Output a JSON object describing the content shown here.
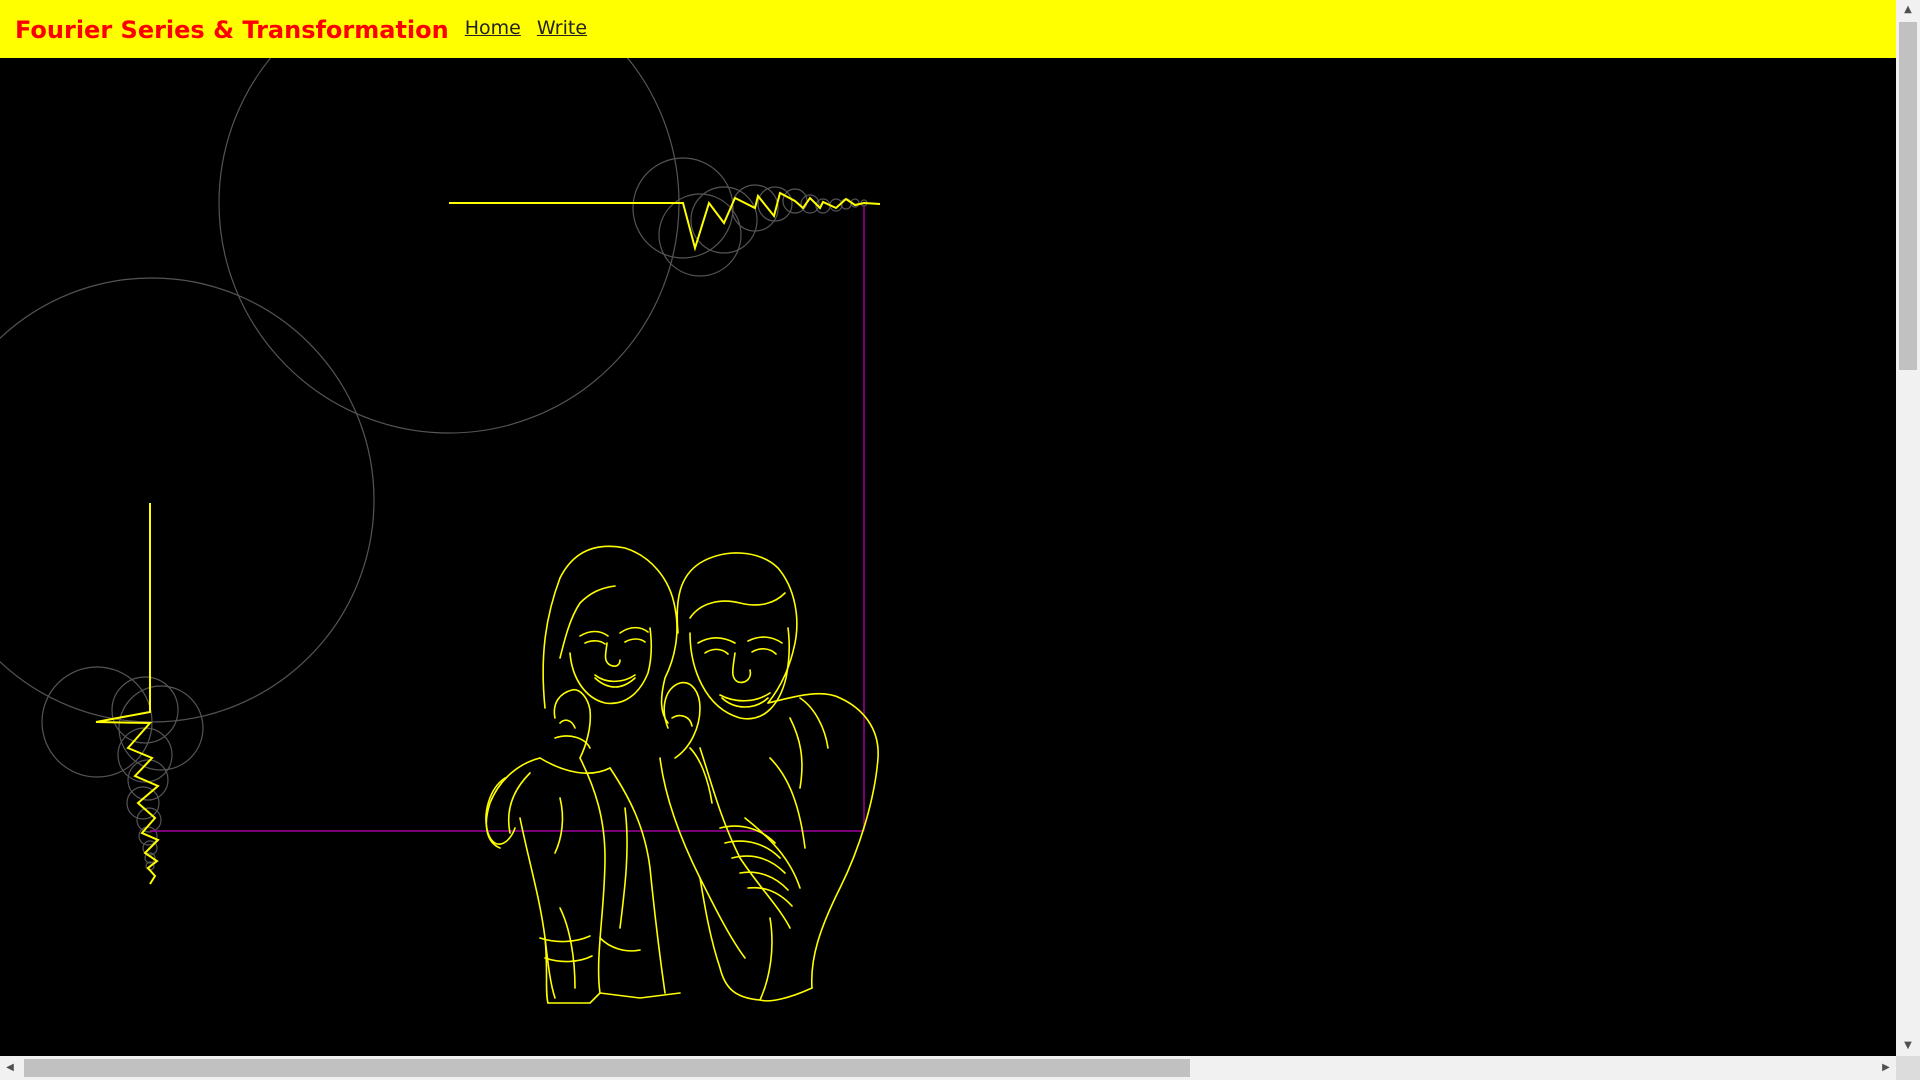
{
  "navbar": {
    "brand": "Fourier Series & Transformation",
    "links": [
      "Home",
      "Write"
    ],
    "background": "#ffff00",
    "brand_color": "#ff0000"
  },
  "canvas": {
    "background": "#000000",
    "drawing_color": "#ffff00",
    "circle_color": "#555555",
    "connector_color": "#aa00aa"
  },
  "scrollbars": {
    "up_arrow": "▲",
    "down_arrow": "▼",
    "left_arrow": "◀",
    "right_arrow": "▶"
  }
}
